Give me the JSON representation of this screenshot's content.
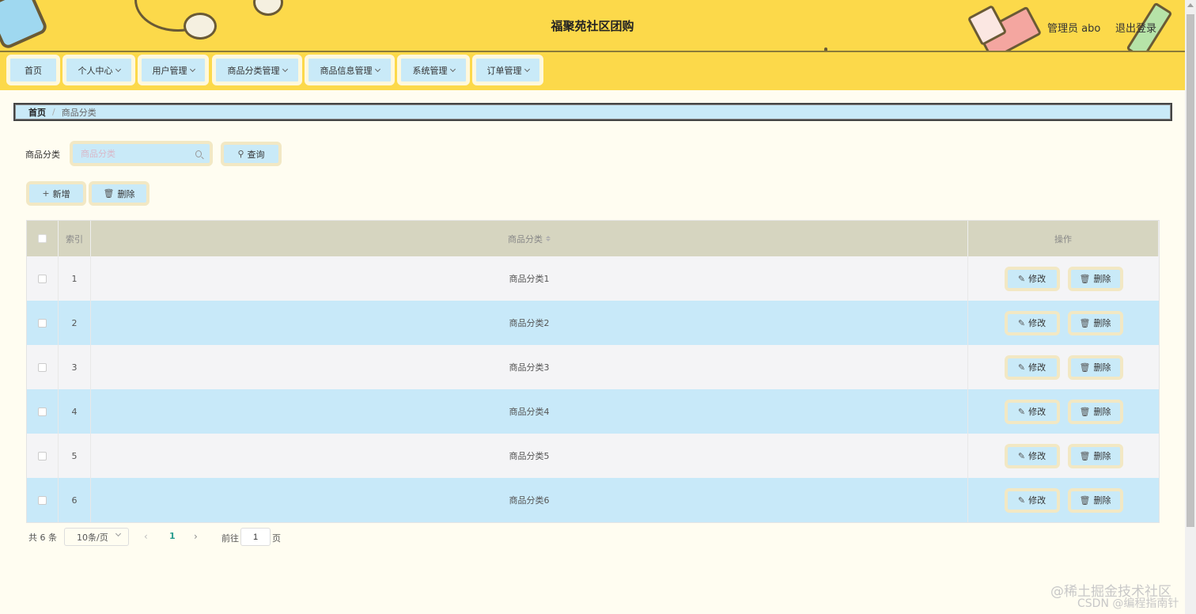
{
  "header": {
    "title": "福聚苑社区团购",
    "user_label": "管理员 abo",
    "logout_label": "退出登录"
  },
  "nav": {
    "items": [
      {
        "label": "首页",
        "has_dropdown": false
      },
      {
        "label": "个人中心",
        "has_dropdown": true
      },
      {
        "label": "用户管理",
        "has_dropdown": true
      },
      {
        "label": "商品分类管理",
        "has_dropdown": true
      },
      {
        "label": "商品信息管理",
        "has_dropdown": true
      },
      {
        "label": "系统管理",
        "has_dropdown": true
      },
      {
        "label": "订单管理",
        "has_dropdown": true
      }
    ]
  },
  "breadcrumb": {
    "home": "首页",
    "separator": "/",
    "current": "商品分类"
  },
  "search": {
    "label": "商品分类",
    "placeholder": "商品分类",
    "value": "",
    "query_button": "查询"
  },
  "actions": {
    "add_label": "新增",
    "delete_label": "删除"
  },
  "table": {
    "columns": {
      "index": "索引",
      "name": "商品分类",
      "ops": "操作"
    },
    "rows": [
      {
        "index": "1",
        "name": "商品分类1"
      },
      {
        "index": "2",
        "name": "商品分类2"
      },
      {
        "index": "3",
        "name": "商品分类3"
      },
      {
        "index": "4",
        "name": "商品分类4"
      },
      {
        "index": "5",
        "name": "商品分类5"
      },
      {
        "index": "6",
        "name": "商品分类6"
      }
    ],
    "row_edit_label": "修改",
    "row_delete_label": "删除"
  },
  "pagination": {
    "total_text": "共 6 条",
    "page_size": "10条/页",
    "current_page": "1",
    "goto_label": "前往",
    "goto_value": "1",
    "page_suffix": "页"
  },
  "watermark": {
    "line1": "@稀土掘金技术社区",
    "line2": "CSDN @编程指南针"
  },
  "colors": {
    "header_bg": "#fcd94a",
    "button_bg": "#c9eaf8",
    "table_head_bg": "#d6d5c0",
    "row_alt_bg": "#c8e9f9",
    "page_bg": "#fffdf1"
  }
}
